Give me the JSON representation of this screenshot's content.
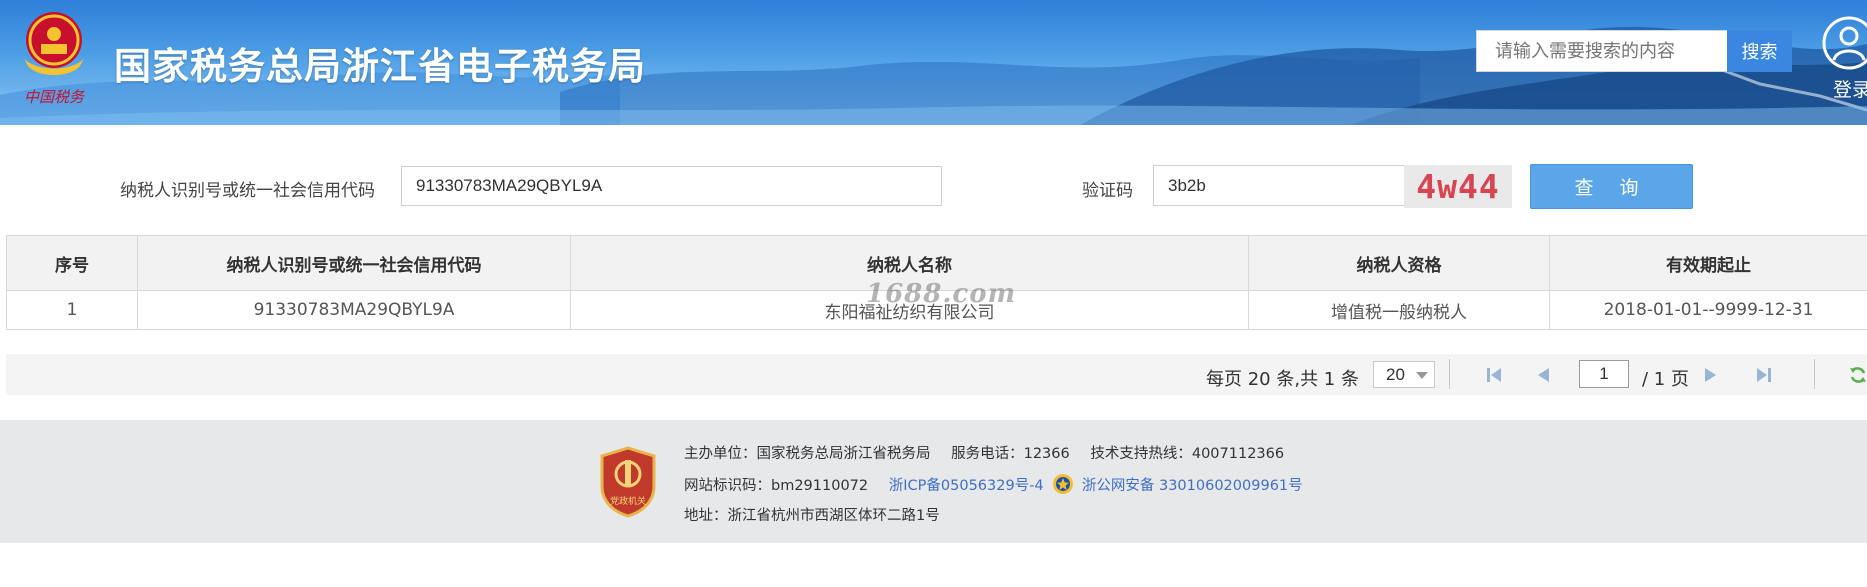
{
  "header": {
    "site_title": "国家税务总局浙江省电子税务局",
    "emblem_alt": "中国税务",
    "search_placeholder": "请输入需要搜索的内容",
    "search_button": "搜索",
    "login_label": "登录"
  },
  "query_form": {
    "taxpayer_id_label": "纳税人识别号或统一社会信用代码",
    "taxpayer_id_value": "91330783MA29QBYL9A",
    "captcha_label": "验证码",
    "captcha_input_value": "3b2b",
    "captcha_image_text": "4w44",
    "query_button": "查 询"
  },
  "results_table": {
    "columns": [
      "序号",
      "纳税人识别号或统一社会信用代码",
      "纳税人名称",
      "纳税人资格",
      "有效期起止"
    ],
    "rows": [
      [
        "1",
        "91330783MA29QBYL9A",
        "东阳福祉纺织有限公司",
        "增值税一般纳税人",
        "2018-01-01--9999-12-31"
      ]
    ],
    "watermark": "1688.com"
  },
  "pagination": {
    "summary": "每页 20 条,共 1 条",
    "page_size": "20",
    "current_page": "1",
    "total_pages": "/ 1 页"
  },
  "footer": {
    "host": "主办单位：国家税务总局浙江省税务局",
    "service_phone": "服务电话：12366",
    "support_hotline": "技术支持热线：4007112366",
    "site_id": "网站标识码：bm29110072",
    "icp": "浙ICP备05056329号-4",
    "public_security": "浙公网安备 33010602009961号",
    "address": "地址：浙江省杭州市西湖区体环二路1号",
    "badge_text": "党政机关"
  },
  "colors": {
    "header_blue": "#2d7fd9",
    "search_button": "#3a86e0",
    "query_button": "#5aa6e9",
    "captcha_text": "#d94452",
    "link_blue": "#3f6fc8",
    "footer_bg": "#e7e8ea"
  },
  "icons": [
    "national-emblem-icon",
    "user-login-icon",
    "first-page-icon",
    "prev-page-icon",
    "next-page-icon",
    "last-page-icon",
    "refresh-icon",
    "party-gov-badge-icon",
    "police-badge-icon"
  ]
}
